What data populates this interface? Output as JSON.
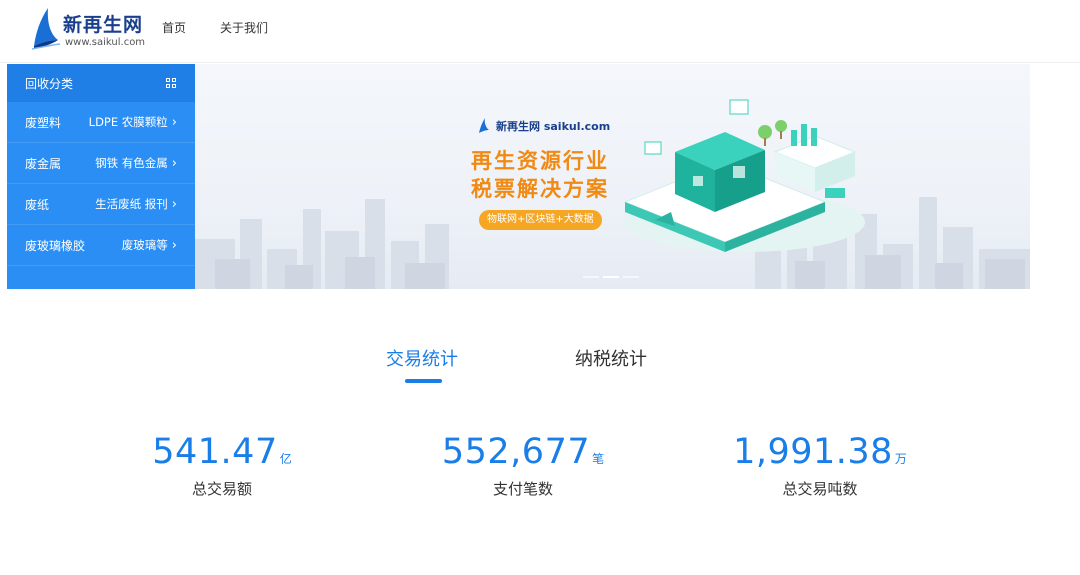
{
  "header": {
    "logo": {
      "name": "新再生网",
      "url": "www.saikul.com"
    },
    "nav": [
      {
        "label": "首页"
      },
      {
        "label": "关于我们"
      }
    ]
  },
  "sidebar": {
    "title": "回收分类",
    "title_icon": "grid-icon",
    "items": [
      {
        "category": "废塑料",
        "subcategories": "LDPE 农膜颗粒"
      },
      {
        "category": "废金属",
        "subcategories": "钢铁 有色金属"
      },
      {
        "category": "废纸",
        "subcategories": "生活废纸 报刊"
      },
      {
        "category": "废玻璃橡胶",
        "subcategories": "废玻璃等"
      }
    ]
  },
  "banner": {
    "brand": "新再生网 saikul.com",
    "title_line1": "再生资源行业",
    "title_line2": "税票解决方案",
    "tagline": "物联网+区块链+大数据",
    "slides": 3,
    "active_slide": 1
  },
  "tabs": [
    {
      "label": "交易统计",
      "active": true
    },
    {
      "label": "纳税统计",
      "active": false
    }
  ],
  "stats": [
    {
      "value": "541.47",
      "unit": "亿",
      "label": "总交易额"
    },
    {
      "value": "552,677",
      "unit": "笔",
      "label": "支付笔数"
    },
    {
      "value": "1,991.38",
      "unit": "万",
      "label": "总交易吨数"
    }
  ],
  "colors": {
    "primary": "#1a7ee8",
    "sidebar": "#2a8ef5",
    "sidebar_header": "#1f7fe6",
    "banner_title": "#f08a14",
    "brand_navy": "#1a3f8c"
  }
}
